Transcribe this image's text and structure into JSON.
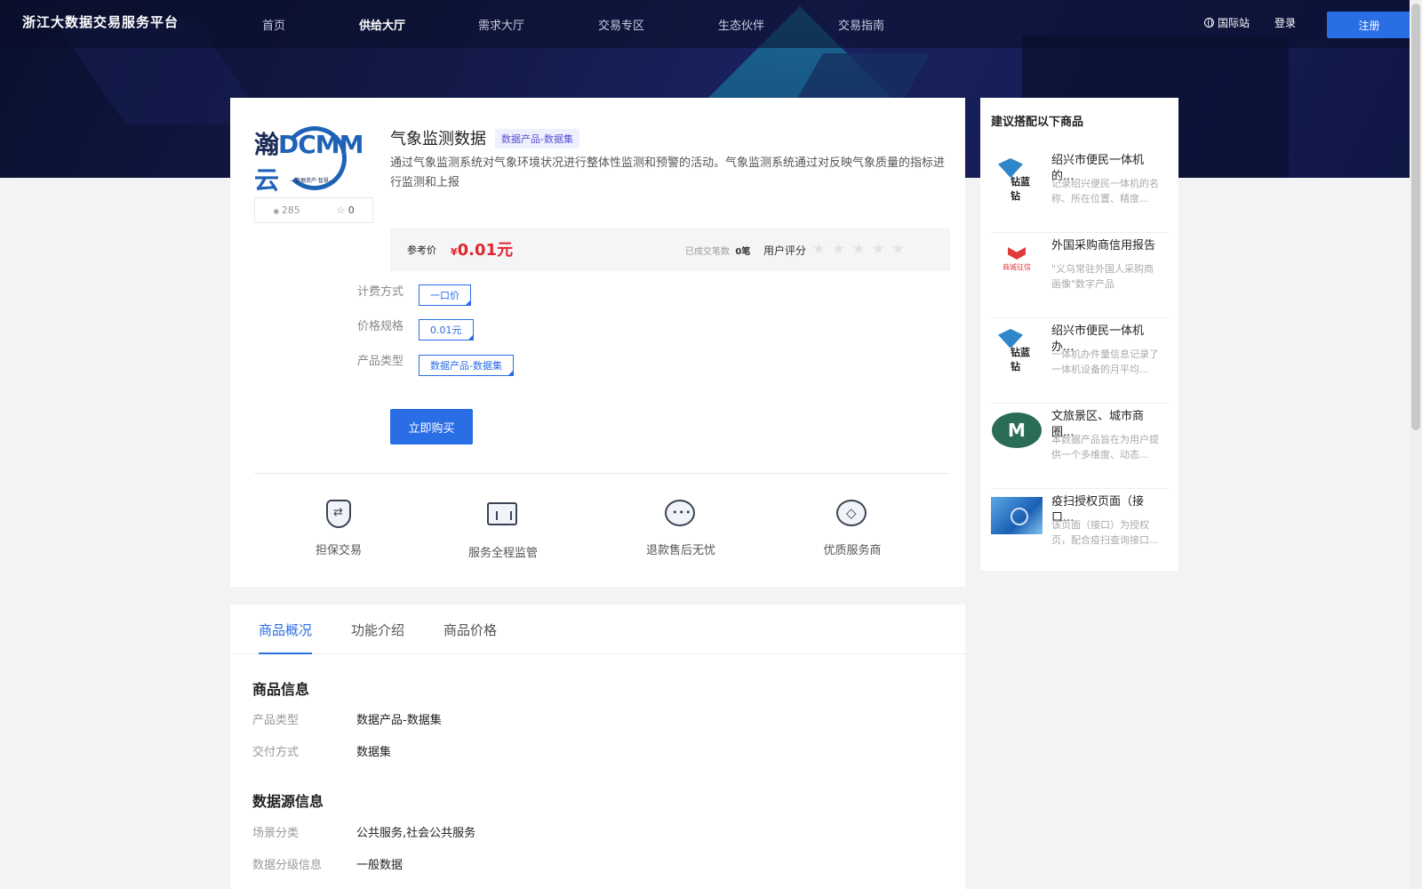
{
  "header": {
    "logo": "浙江大数据交易服务平台",
    "nav": [
      "首页",
      "供给大厅",
      "需求大厅",
      "交易专区",
      "生态伙伴",
      "交易指南"
    ],
    "active_nav": "供给大厅",
    "intl": "国际站",
    "login": "登录",
    "register": "注册"
  },
  "product": {
    "logo_text_dark": "瀚",
    "logo_text": "DCMM云",
    "logo_sub": "—数据资产·智慧—",
    "views": "285",
    "favorites": "0",
    "title": "气象监测数据",
    "tag": "数据产品-数据集",
    "description": "通过气象监测系统对气象环境状况进行整体性监测和预警的活动。气象监测系统通过对反映气象质量的指标进行监测和上报",
    "price_label": "参考价",
    "currency": "¥",
    "price": "0.01元",
    "deals_label": "已成交笔数",
    "deals_count": "0笔",
    "rating_label": "用户评分",
    "stars": "★★★★★",
    "rating": 0,
    "options": [
      {
        "label": "计费方式",
        "value": "一口价"
      },
      {
        "label": "价格规格",
        "value": "0.01元"
      },
      {
        "label": "产品类型",
        "value": "数据产品-数据集"
      }
    ],
    "buy": "立即购买",
    "features": [
      "担保交易",
      "服务全程监管",
      "退款售后无忧",
      "优质服务商"
    ]
  },
  "sidebar": {
    "title": "建议搭配以下商品",
    "items": [
      {
        "title": "绍兴市便民一体机的...",
        "desc": "记录绍兴便民一体机的名称、所在位置、精度...",
        "thumb": "钻蓝钻"
      },
      {
        "title": "外国采购商信用报告",
        "desc": "\"义乌常驻外国人采购商画像\"数字产品",
        "thumb": "商城征信"
      },
      {
        "title": "绍兴市便民一体机办...",
        "desc": "一体机办件量信息记录了一体机设备的月平均...",
        "thumb": "钻蓝钻"
      },
      {
        "title": "文旅景区、城市商圈...",
        "desc": "本数据产品旨在为用户提供一个多维度、动态...",
        "thumb": "M"
      },
      {
        "title": "疫扫授权页面（接口...",
        "desc": "该页面（接口）为授权页，配合疫扫查询接口...",
        "thumb": ""
      }
    ]
  },
  "tabs": {
    "items": [
      "商品概况",
      "功能介绍",
      "商品价格"
    ],
    "active": "商品概况"
  },
  "info": {
    "section1": "商品信息",
    "rows1": [
      {
        "k": "产品类型",
        "v": "数据产品-数据集"
      },
      {
        "k": "交付方式",
        "v": "数据集"
      }
    ],
    "section2": "数据源信息",
    "rows2": [
      {
        "k": "场景分类",
        "v": "公共服务,社会公共服务"
      },
      {
        "k": "数据分级信息",
        "v": "一般数据"
      }
    ]
  },
  "colors": {
    "accent": "#2a6ee6",
    "price": "#e0262f",
    "hero": "#141b4a"
  }
}
